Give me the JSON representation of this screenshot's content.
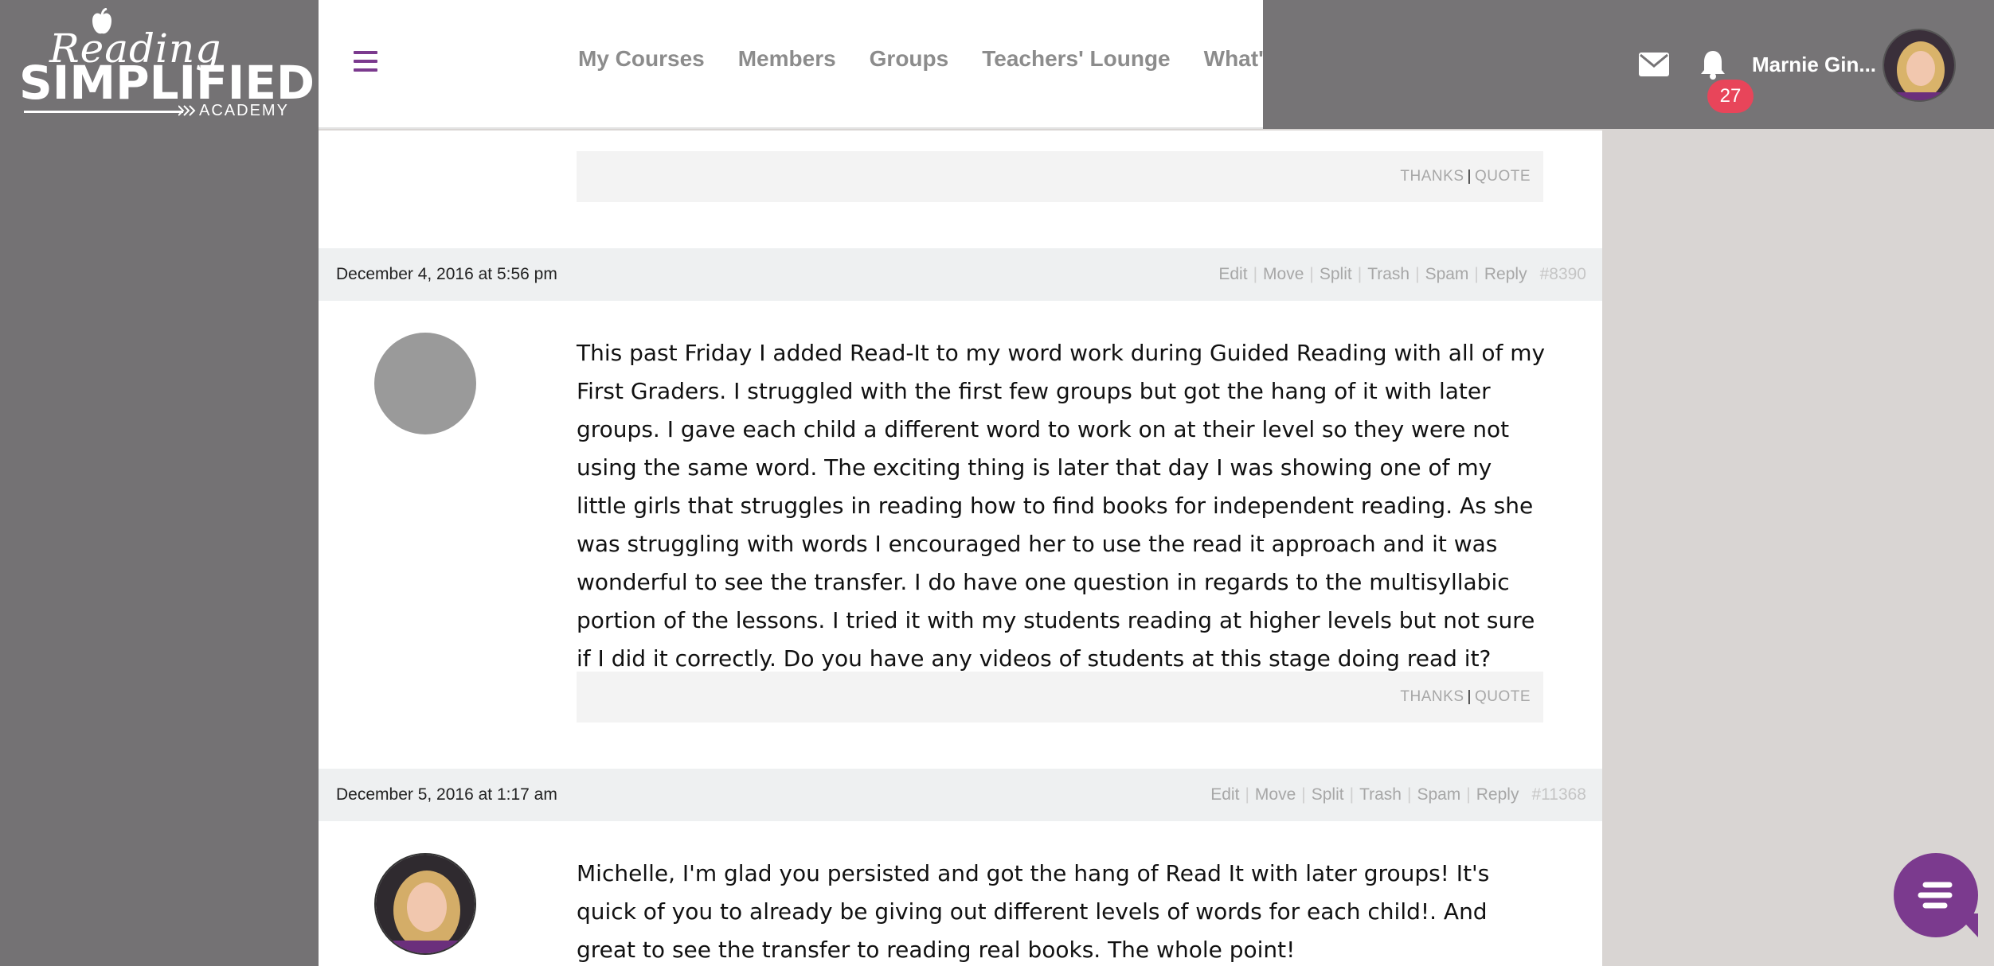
{
  "logo": {
    "line1": "Reading",
    "line2": "SIMPLIFIED",
    "line3": "ACADEMY"
  },
  "nav": {
    "items": [
      {
        "label": "My Courses"
      },
      {
        "label": "Members"
      },
      {
        "label": "Groups"
      },
      {
        "label": "Teachers' Lounge"
      },
      {
        "label": "What's New"
      }
    ]
  },
  "header": {
    "notification_count": "27",
    "user_name": "Marnie Gin..."
  },
  "post_footer": {
    "thanks": "THANKS",
    "separator": "|",
    "quote": "QUOTE"
  },
  "action_labels": {
    "edit": "Edit",
    "move": "Move",
    "split": "Split",
    "trash": "Trash",
    "spam": "Spam",
    "reply": "Reply"
  },
  "replies": [
    {
      "date": "December 4, 2016 at 5:56 pm",
      "post_id": "#8390",
      "text": "This past Friday I added Read-It to my word work during Guided Reading with all of my First Graders. I struggled with the first few groups but got the hang of it with later groups. I gave each child a different word to work on at their level so they were not using the same word. The exciting thing is later that day I was showing one of my little girls that struggles in reading how to find books for independent reading. As she was struggling with words I encouraged her to use the read it approach and it was wonderful to see the transfer. I do have one question in regards to the multisyllabic portion of the lessons. I tried it with my students reading at higher levels but not sure if I did it correctly. Do you have any videos of students at this stage doing read it?"
    },
    {
      "date": "December 5, 2016 at 1:17 am",
      "post_id": "#11368",
      "text": "Michelle, I'm glad you persisted and got the hang of Read It with later groups! It's quick of you to already be giving out different levels of words for each child!. And great to see the transfer to reading real books. The whole point!"
    }
  ],
  "colors": {
    "brand_purple": "#7b3a8e",
    "badge_red": "#e8455a",
    "rail_gray": "#747274"
  }
}
